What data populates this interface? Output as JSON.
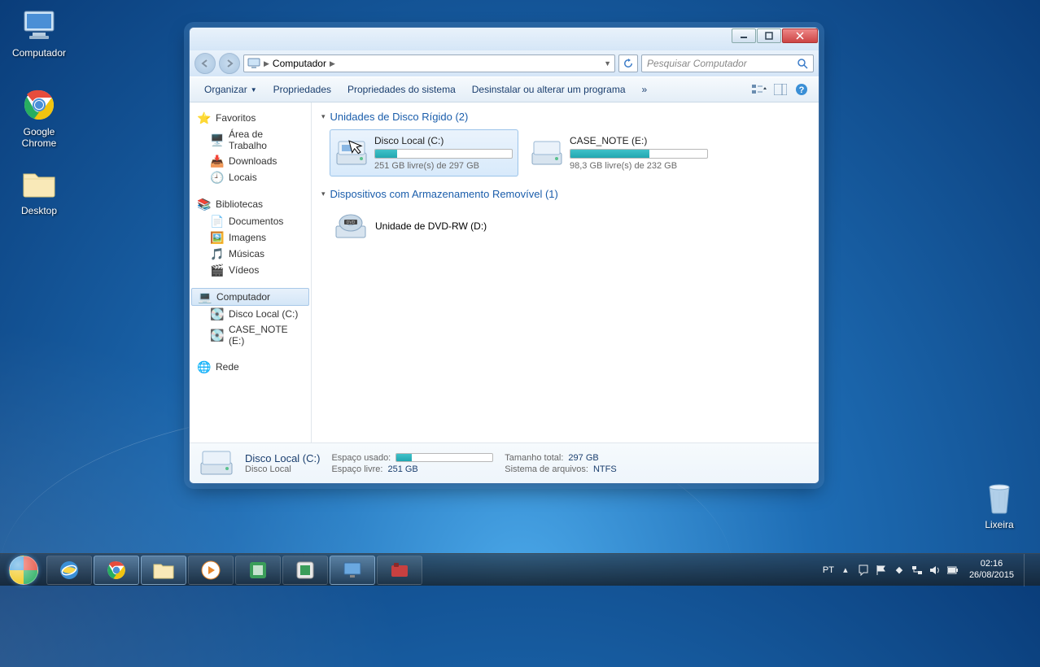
{
  "desktop": {
    "icons": {
      "computer": "Computador",
      "chrome": "Google Chrome",
      "desktop_folder": "Desktop",
      "recycle_bin": "Lixeira"
    }
  },
  "window": {
    "breadcrumb": "Computador",
    "search_placeholder": "Pesquisar Computador",
    "toolbar": {
      "organize": "Organizar",
      "properties": "Propriedades",
      "system_properties": "Propriedades do sistema",
      "uninstall": "Desinstalar ou alterar um programa",
      "more": "»"
    },
    "sidebar": {
      "favorites": {
        "title": "Favoritos",
        "items": [
          "Área de Trabalho",
          "Downloads",
          "Locais"
        ]
      },
      "libraries": {
        "title": "Bibliotecas",
        "items": [
          "Documentos",
          "Imagens",
          "Músicas",
          "Vídeos"
        ]
      },
      "computer": {
        "title": "Computador",
        "items": [
          "Disco Local (C:)",
          "CASE_NOTE (E:)"
        ]
      },
      "network": {
        "title": "Rede"
      }
    },
    "groups": {
      "hdd": {
        "label": "Unidades de Disco Rígido (2)"
      },
      "removable": {
        "label": "Dispositivos com Armazenamento Removível (1)"
      }
    },
    "drives": [
      {
        "name": "Disco Local (C:)",
        "free_text": "251 GB livre(s) de 297 GB",
        "used_percent": 16,
        "selected": true
      },
      {
        "name": "CASE_NOTE (E:)",
        "free_text": "98,3 GB livre(s) de 232 GB",
        "used_percent": 58,
        "selected": false
      }
    ],
    "removable": [
      {
        "name": "Unidade de DVD-RW (D:)"
      }
    ],
    "details": {
      "title": "Disco Local (C:)",
      "subtitle": "Disco Local",
      "used_label": "Espaço usado:",
      "used_percent": 16,
      "free_label": "Espaço livre:",
      "free_value": "251 GB",
      "total_label": "Tamanho total:",
      "total_value": "297 GB",
      "fs_label": "Sistema de arquivos:",
      "fs_value": "NTFS"
    }
  },
  "taskbar": {
    "lang": "PT",
    "time": "02:16",
    "date": "26/08/2015"
  }
}
